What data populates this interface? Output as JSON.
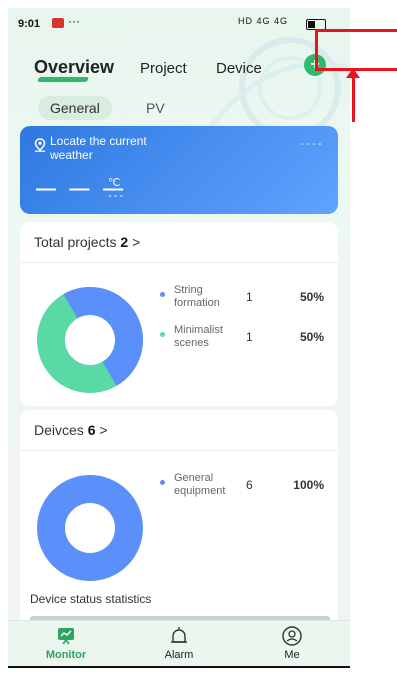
{
  "status_bar": {
    "time": "9:01",
    "more": "···",
    "network": "HD 4G 4G"
  },
  "top_tabs": [
    {
      "label": "Overview",
      "active": true
    },
    {
      "label": "Project",
      "active": false
    },
    {
      "label": "Device",
      "active": false
    }
  ],
  "sub_tabs": [
    {
      "label": "General",
      "active": true
    },
    {
      "label": "PV",
      "active": false
    }
  ],
  "weather": {
    "locate_text": "Locate the current weather",
    "top_right_dashes": "----",
    "temperature": "— — —",
    "unit": "℃",
    "unit_sub": "---"
  },
  "projects_card": {
    "title": "Total projects",
    "count": "2",
    "chevron": ">",
    "legend": [
      {
        "name": "String formation",
        "count": "1",
        "percent": "50%",
        "color": "#5b8ff9"
      },
      {
        "name": "Minimalist scenes",
        "count": "1",
        "percent": "50%",
        "color": "#5ad8a6"
      }
    ]
  },
  "devices_card": {
    "title": "Deivces",
    "count": "6",
    "chevron": ">",
    "legend": [
      {
        "name": "General equipment",
        "count": "6",
        "percent": "100%",
        "color": "#5b8ff9"
      }
    ]
  },
  "device_status_label": "Device status statistics",
  "bottom_nav": [
    {
      "label": "Monitor",
      "icon": "monitor-icon",
      "active": true
    },
    {
      "label": "Alarm",
      "icon": "bell-icon",
      "active": false
    },
    {
      "label": "Me",
      "icon": "user-icon",
      "active": false
    }
  ],
  "colors": {
    "accent": "#2fb970",
    "weather_blue": "#3a82ea",
    "annotation_red": "#e8141c"
  }
}
